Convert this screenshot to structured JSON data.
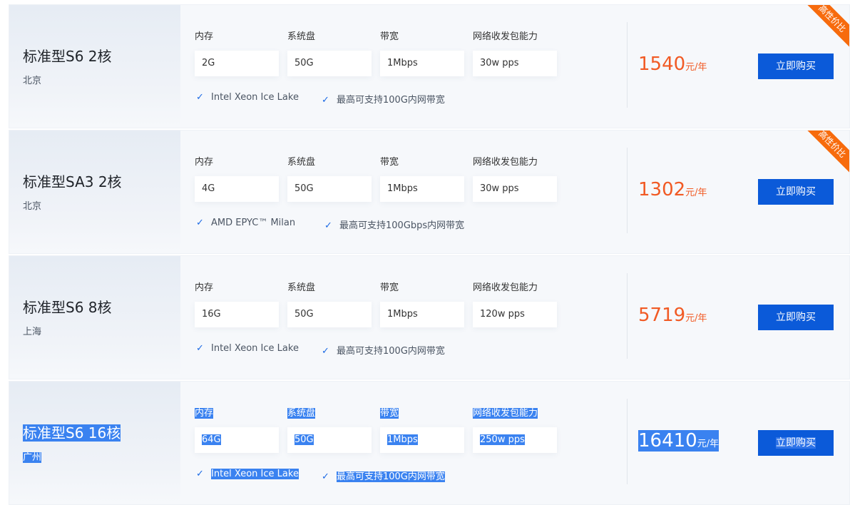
{
  "spec_labels": {
    "memory": "内存",
    "disk": "系统盘",
    "bandwidth": "带宽",
    "pps": "网络收发包能力"
  },
  "buy_label": "立即购买",
  "badge_label": "高性价比",
  "price_unit": "元/年",
  "colors": {
    "price": "#f15a24",
    "button": "#0b5ad9",
    "badge": "#f76b0d",
    "selection": "#3a82f0"
  },
  "products": [
    {
      "name": "标准型S6 2核",
      "region": "北京",
      "memory": "2G",
      "disk": "50G",
      "bandwidth": "1Mbps",
      "pps": "30w pps",
      "feature1": "Intel Xeon Ice Lake",
      "feature2": "最高可支持100G内网带宽",
      "price": "1540",
      "badge": true
    },
    {
      "name": "标准型SA3 2核",
      "region": "北京",
      "memory": "4G",
      "disk": "50G",
      "bandwidth": "1Mbps",
      "pps": "30w pps",
      "feature1": "AMD EPYC™ Milan",
      "feature2": "最高可支持100Gbps内网带宽",
      "price": "1302",
      "badge": true
    },
    {
      "name": "标准型S6 8核",
      "region": "上海",
      "memory": "16G",
      "disk": "50G",
      "bandwidth": "1Mbps",
      "pps": "120w pps",
      "feature1": "Intel Xeon Ice Lake",
      "feature2": "最高可支持100G内网带宽",
      "price": "5719",
      "badge": false
    },
    {
      "name": "标准型S6 16核",
      "region": "广州",
      "memory": "64G",
      "disk": "50G",
      "bandwidth": "1Mbps",
      "pps": "250w pps",
      "feature1": "Intel Xeon Ice Lake",
      "feature2": "最高可支持100G内网带宽",
      "price": "16410",
      "badge": false,
      "text_selected": true
    }
  ]
}
